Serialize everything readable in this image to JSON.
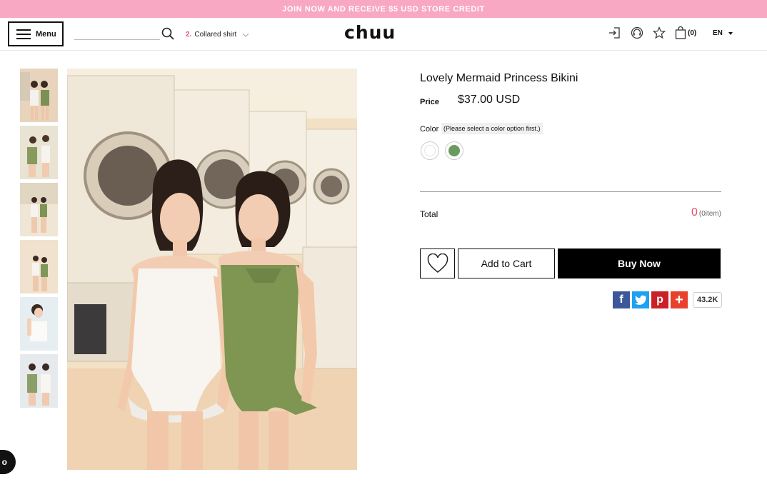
{
  "promo": {
    "text": "JOIN NOW AND RECEIVE $5 USD STORE CREDIT"
  },
  "header": {
    "menu_label": "Menu",
    "search": {
      "placeholder": "",
      "value": ""
    },
    "trending": {
      "rank": "2.",
      "term": "Collared shirt"
    },
    "logo": "chuu",
    "cart_count": "(0)",
    "language": "EN"
  },
  "product": {
    "title": "Lovely Mermaid Princess Bikini",
    "price_label": "Price",
    "price": "$37.00 USD",
    "color_label": "Color",
    "color_note": "(Please select a color option first.)",
    "colors": [
      {
        "name": "White",
        "hex": "#ffffff"
      },
      {
        "name": "Green",
        "hex": "#6a9a60"
      }
    ],
    "total_label": "Total",
    "total_value": "0",
    "total_items": "(0item)",
    "add_to_cart": "Add to Cart",
    "buy_now": "Buy Now"
  },
  "share": {
    "networks": [
      {
        "name": "facebook",
        "glyph": "f",
        "color": "#3b5998"
      },
      {
        "name": "twitter",
        "glyph": "t",
        "color": "#1da1f2"
      },
      {
        "name": "pinterest",
        "glyph": "p",
        "color": "#cb2027"
      },
      {
        "name": "more",
        "glyph": "+",
        "color": "#e8412c"
      }
    ],
    "count": "43.2K"
  },
  "chat": {
    "glyph": "o"
  },
  "gallery": {
    "thumbnail_count": 6
  }
}
